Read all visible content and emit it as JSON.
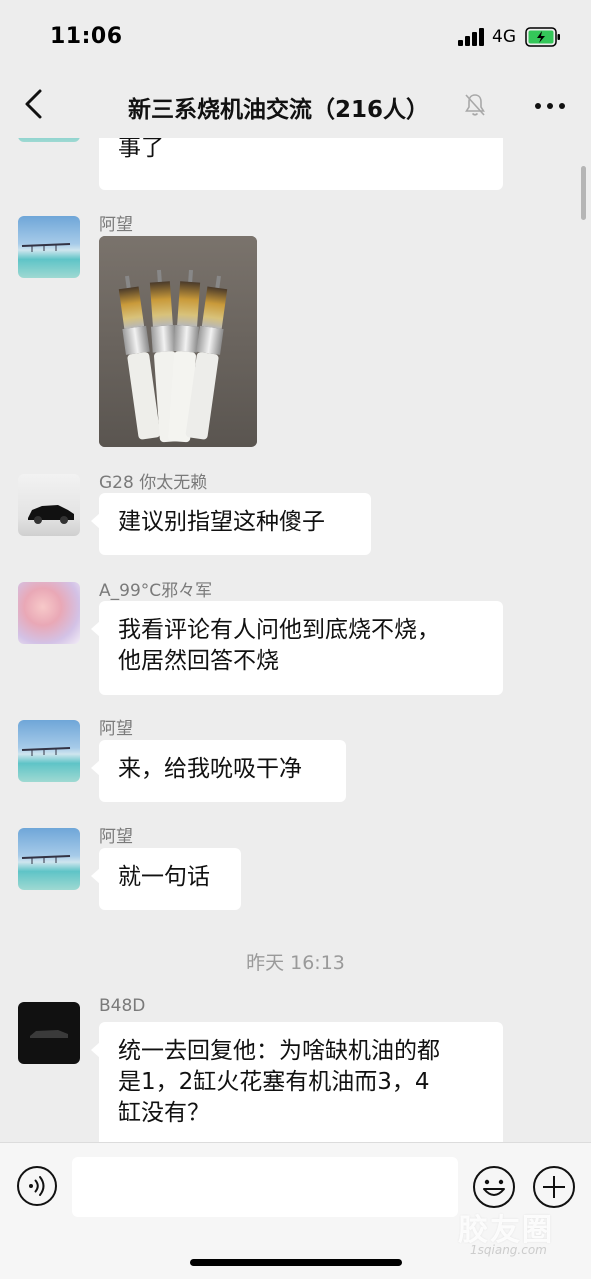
{
  "status_bar": {
    "time": "11:06",
    "network": "4G"
  },
  "nav": {
    "title": "新三系烧机油交流（216人）"
  },
  "chat": {
    "partial_message": "事了",
    "messages": [
      {
        "sender": "阿望",
        "type": "image"
      },
      {
        "sender": "G28 你太无赖",
        "text": "建议别指望这种傻子"
      },
      {
        "sender": "A_99°C邪々军",
        "text_line1": "我看评论有人问他到底烧不烧，",
        "text_line2": "他居然回答不烧"
      },
      {
        "sender": "阿望",
        "text": "来，给我吮吸干净"
      },
      {
        "sender": "阿望",
        "text": "就一句话"
      }
    ],
    "timestamp": "昨天 16:13",
    "last_message": {
      "sender": "B48D",
      "line1": "统一去回复他：为啥缺机油的都",
      "line2": "是1，2缸火花塞有机油而3，4",
      "line3": "缸没有？"
    }
  },
  "input": {
    "placeholder": ""
  },
  "watermark": {
    "main": "胶友圈",
    "sub": "1sqiang.com"
  },
  "icons": {
    "back": "chevron-left-icon",
    "mute": "bell-muted-icon",
    "more": "more-dots-icon",
    "voice": "voice-icon",
    "emoji": "emoji-icon",
    "plus": "plus-icon"
  },
  "colors": {
    "background": "#ededed",
    "bubble": "#ffffff",
    "battery": "#34c759"
  }
}
